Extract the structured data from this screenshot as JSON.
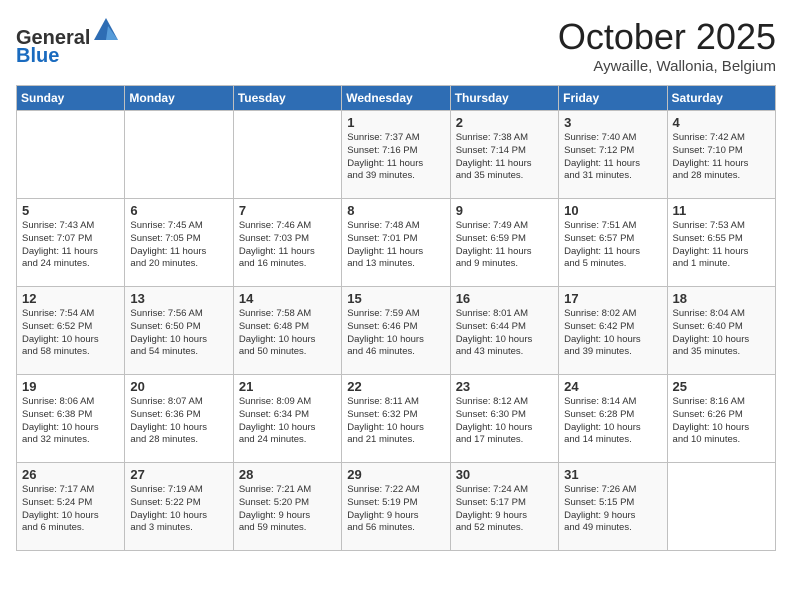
{
  "header": {
    "logo_general": "General",
    "logo_blue": "Blue",
    "month_title": "October 2025",
    "subtitle": "Aywaille, Wallonia, Belgium"
  },
  "days_of_week": [
    "Sunday",
    "Monday",
    "Tuesday",
    "Wednesday",
    "Thursday",
    "Friday",
    "Saturday"
  ],
  "weeks": [
    [
      {
        "day": "",
        "info": ""
      },
      {
        "day": "",
        "info": ""
      },
      {
        "day": "",
        "info": ""
      },
      {
        "day": "1",
        "info": "Sunrise: 7:37 AM\nSunset: 7:16 PM\nDaylight: 11 hours\nand 39 minutes."
      },
      {
        "day": "2",
        "info": "Sunrise: 7:38 AM\nSunset: 7:14 PM\nDaylight: 11 hours\nand 35 minutes."
      },
      {
        "day": "3",
        "info": "Sunrise: 7:40 AM\nSunset: 7:12 PM\nDaylight: 11 hours\nand 31 minutes."
      },
      {
        "day": "4",
        "info": "Sunrise: 7:42 AM\nSunset: 7:10 PM\nDaylight: 11 hours\nand 28 minutes."
      }
    ],
    [
      {
        "day": "5",
        "info": "Sunrise: 7:43 AM\nSunset: 7:07 PM\nDaylight: 11 hours\nand 24 minutes."
      },
      {
        "day": "6",
        "info": "Sunrise: 7:45 AM\nSunset: 7:05 PM\nDaylight: 11 hours\nand 20 minutes."
      },
      {
        "day": "7",
        "info": "Sunrise: 7:46 AM\nSunset: 7:03 PM\nDaylight: 11 hours\nand 16 minutes."
      },
      {
        "day": "8",
        "info": "Sunrise: 7:48 AM\nSunset: 7:01 PM\nDaylight: 11 hours\nand 13 minutes."
      },
      {
        "day": "9",
        "info": "Sunrise: 7:49 AM\nSunset: 6:59 PM\nDaylight: 11 hours\nand 9 minutes."
      },
      {
        "day": "10",
        "info": "Sunrise: 7:51 AM\nSunset: 6:57 PM\nDaylight: 11 hours\nand 5 minutes."
      },
      {
        "day": "11",
        "info": "Sunrise: 7:53 AM\nSunset: 6:55 PM\nDaylight: 11 hours\nand 1 minute."
      }
    ],
    [
      {
        "day": "12",
        "info": "Sunrise: 7:54 AM\nSunset: 6:52 PM\nDaylight: 10 hours\nand 58 minutes."
      },
      {
        "day": "13",
        "info": "Sunrise: 7:56 AM\nSunset: 6:50 PM\nDaylight: 10 hours\nand 54 minutes."
      },
      {
        "day": "14",
        "info": "Sunrise: 7:58 AM\nSunset: 6:48 PM\nDaylight: 10 hours\nand 50 minutes."
      },
      {
        "day": "15",
        "info": "Sunrise: 7:59 AM\nSunset: 6:46 PM\nDaylight: 10 hours\nand 46 minutes."
      },
      {
        "day": "16",
        "info": "Sunrise: 8:01 AM\nSunset: 6:44 PM\nDaylight: 10 hours\nand 43 minutes."
      },
      {
        "day": "17",
        "info": "Sunrise: 8:02 AM\nSunset: 6:42 PM\nDaylight: 10 hours\nand 39 minutes."
      },
      {
        "day": "18",
        "info": "Sunrise: 8:04 AM\nSunset: 6:40 PM\nDaylight: 10 hours\nand 35 minutes."
      }
    ],
    [
      {
        "day": "19",
        "info": "Sunrise: 8:06 AM\nSunset: 6:38 PM\nDaylight: 10 hours\nand 32 minutes."
      },
      {
        "day": "20",
        "info": "Sunrise: 8:07 AM\nSunset: 6:36 PM\nDaylight: 10 hours\nand 28 minutes."
      },
      {
        "day": "21",
        "info": "Sunrise: 8:09 AM\nSunset: 6:34 PM\nDaylight: 10 hours\nand 24 minutes."
      },
      {
        "day": "22",
        "info": "Sunrise: 8:11 AM\nSunset: 6:32 PM\nDaylight: 10 hours\nand 21 minutes."
      },
      {
        "day": "23",
        "info": "Sunrise: 8:12 AM\nSunset: 6:30 PM\nDaylight: 10 hours\nand 17 minutes."
      },
      {
        "day": "24",
        "info": "Sunrise: 8:14 AM\nSunset: 6:28 PM\nDaylight: 10 hours\nand 14 minutes."
      },
      {
        "day": "25",
        "info": "Sunrise: 8:16 AM\nSunset: 6:26 PM\nDaylight: 10 hours\nand 10 minutes."
      }
    ],
    [
      {
        "day": "26",
        "info": "Sunrise: 7:17 AM\nSunset: 5:24 PM\nDaylight: 10 hours\nand 6 minutes."
      },
      {
        "day": "27",
        "info": "Sunrise: 7:19 AM\nSunset: 5:22 PM\nDaylight: 10 hours\nand 3 minutes."
      },
      {
        "day": "28",
        "info": "Sunrise: 7:21 AM\nSunset: 5:20 PM\nDaylight: 9 hours\nand 59 minutes."
      },
      {
        "day": "29",
        "info": "Sunrise: 7:22 AM\nSunset: 5:19 PM\nDaylight: 9 hours\nand 56 minutes."
      },
      {
        "day": "30",
        "info": "Sunrise: 7:24 AM\nSunset: 5:17 PM\nDaylight: 9 hours\nand 52 minutes."
      },
      {
        "day": "31",
        "info": "Sunrise: 7:26 AM\nSunset: 5:15 PM\nDaylight: 9 hours\nand 49 minutes."
      },
      {
        "day": "",
        "info": ""
      }
    ]
  ]
}
